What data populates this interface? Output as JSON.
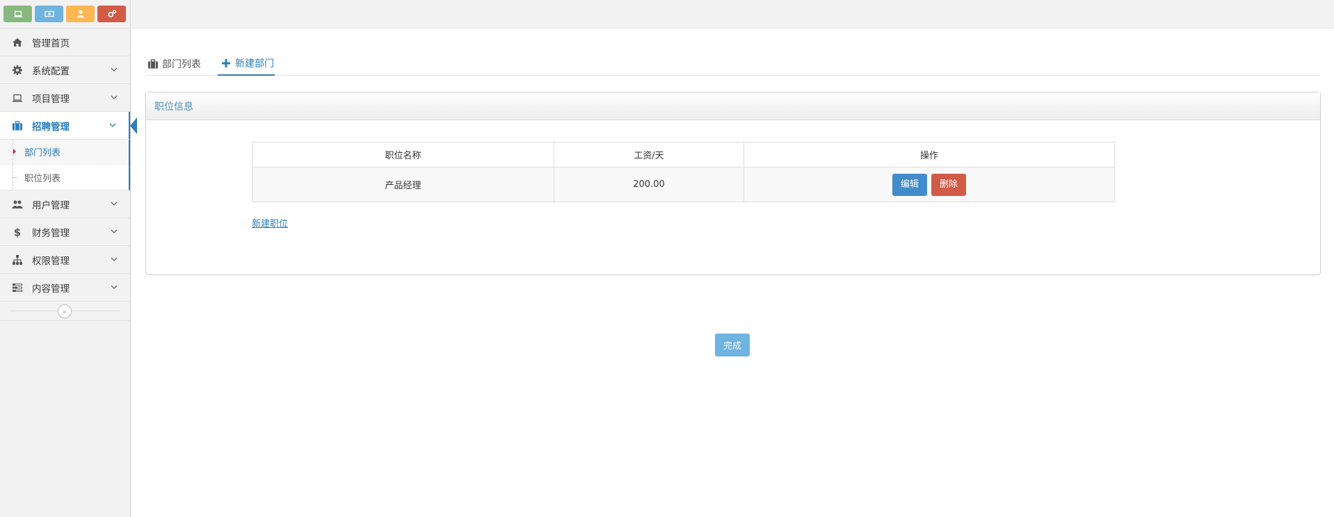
{
  "shortcuts": [
    {
      "icon": "laptop-icon",
      "color": "#87b87f"
    },
    {
      "icon": "money-icon",
      "color": "#6fb3e0"
    },
    {
      "icon": "user-icon",
      "color": "#ffb752"
    },
    {
      "icon": "cogs-icon",
      "color": "#d15b47"
    }
  ],
  "sidebar": {
    "items": [
      {
        "label": "管理首页",
        "icon": "home-icon"
      },
      {
        "label": "系统配置",
        "icon": "gear-icon"
      },
      {
        "label": "项目管理",
        "icon": "laptop-icon"
      },
      {
        "label": "招聘管理",
        "icon": "briefcase-icon"
      },
      {
        "label": "用户管理",
        "icon": "users-icon"
      },
      {
        "label": "财务管理",
        "icon": "dollar-icon"
      },
      {
        "label": "权限管理",
        "icon": "sitemap-icon"
      },
      {
        "label": "内容管理",
        "icon": "list-icon"
      }
    ],
    "subitems": [
      {
        "label": "部门列表"
      },
      {
        "label": "职位列表"
      }
    ],
    "collapse_glyph": "«"
  },
  "tabs": [
    {
      "label": "部门列表",
      "icon": "briefcase-icon"
    },
    {
      "label": "新建部门",
      "icon": "plus-icon"
    }
  ],
  "panel": {
    "title": "职位信息",
    "table": {
      "headers": [
        "职位名称",
        "工资/天",
        "操作"
      ],
      "rows": [
        {
          "name": "产品经理",
          "salary": "200.00",
          "edit_label": "编辑",
          "delete_label": "删除"
        }
      ]
    },
    "new_link": "新建职位"
  },
  "done_label": "完成",
  "colors": {
    "accent": "#2b7dbc",
    "edit": "#428bca",
    "delete": "#d15b47",
    "done": "#6fb3e0"
  }
}
